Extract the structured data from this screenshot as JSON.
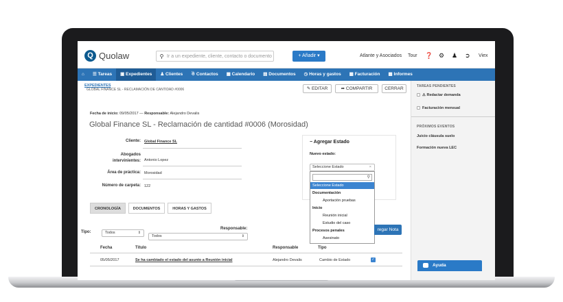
{
  "topbar": {
    "logo_letter": "Q",
    "logo_text": "Quolaw",
    "search_placeholder": "Ir a un expediente, cliente, contacto o documento",
    "add_button": "+ Añadir ▾",
    "firm_name": "Atlante y Asociados",
    "tour": "Tour",
    "user": "Viex"
  },
  "nav": {
    "items": [
      "Tareas",
      "Expedientes",
      "Clientes",
      "Contactos",
      "Calendario",
      "Documentos",
      "Horas y gastos",
      "Facturación",
      "Informes"
    ],
    "active": "Expedientes"
  },
  "breadcrumb": {
    "section": "EXPEDIENTES",
    "case": "GLOBAL FINANCE SL - RECLAMACIÓN DE CANTIDAD #0006"
  },
  "header_actions": {
    "edit": "EDITAR",
    "share": "COMPARTIR",
    "close": "CERRAR"
  },
  "case": {
    "meta_start_label": "Fecha de inicio:",
    "meta_start_value": "09/05/2017",
    "meta_separator": "—",
    "meta_resp_label": "Responsable:",
    "meta_resp_value": "Alejandro Devalis",
    "title": "Global Finance SL - Reclamación de cantidad #0006 (Morosidad)",
    "fields": [
      {
        "label": "Cliente:",
        "value": "Global Finance SL"
      },
      {
        "label": "Abogados intervinientes:",
        "value": "Antonio Lopez"
      },
      {
        "label": "Área de práctica:",
        "value": "Morosidad"
      },
      {
        "label": "Número de carpeta:",
        "value": "122"
      }
    ]
  },
  "estado_panel": {
    "title": "− Agregar Estado",
    "label": "Nuevo estado:",
    "select_value": "Seleccione Estado",
    "select_clear": "×",
    "options": [
      {
        "text": "Seleccione Estado",
        "kind": "highlight"
      },
      {
        "text": "Documentación",
        "kind": "group"
      },
      {
        "text": "Aportación pruebas",
        "kind": "child"
      },
      {
        "text": "Inicio",
        "kind": "group"
      },
      {
        "text": "Reunión inicial",
        "kind": "child"
      },
      {
        "text": "Estudio del caso",
        "kind": "child"
      },
      {
        "text": "Procesos penales",
        "kind": "group"
      },
      {
        "text": "Asesinato",
        "kind": "child"
      }
    ]
  },
  "tabs": [
    "CRONOLOGÍA",
    "DOCUMENTOS",
    "HORAS Y GASTOS"
  ],
  "active_tab": "CRONOLOGÍA",
  "filters": {
    "tipo_label": "Tipo:",
    "tipo_value": "Todos",
    "responsable_label": "Responsable:",
    "responsable_value": "Todos",
    "add_note_button": "regar Nota"
  },
  "table": {
    "headers": [
      "Fecha",
      "Título",
      "Responsable",
      "Tipo"
    ],
    "rows": [
      {
        "fecha": "05/05/2017",
        "titulo": "Se ha cambiado el estado del asunto a Reunión inicial",
        "responsable": "Alejandro Devalis",
        "tipo": "Cambio de Estado",
        "checked": true
      }
    ]
  },
  "sidebar": {
    "tasks_header": "TAREAS PENDIENTES",
    "tasks": [
      "Redactar demanda",
      "Facturación mensual"
    ],
    "events_header": "PRÓXIMOS EVENTOS",
    "events": [
      "Juicio cláusula suelo",
      "Formación nueva LEC"
    ]
  },
  "help_button": "Ayuda",
  "colors": {
    "primary": "#2d74b6",
    "nav_active": "#1f5c96",
    "highlight": "#3b84d0",
    "bezel": "#1b1b1d"
  }
}
